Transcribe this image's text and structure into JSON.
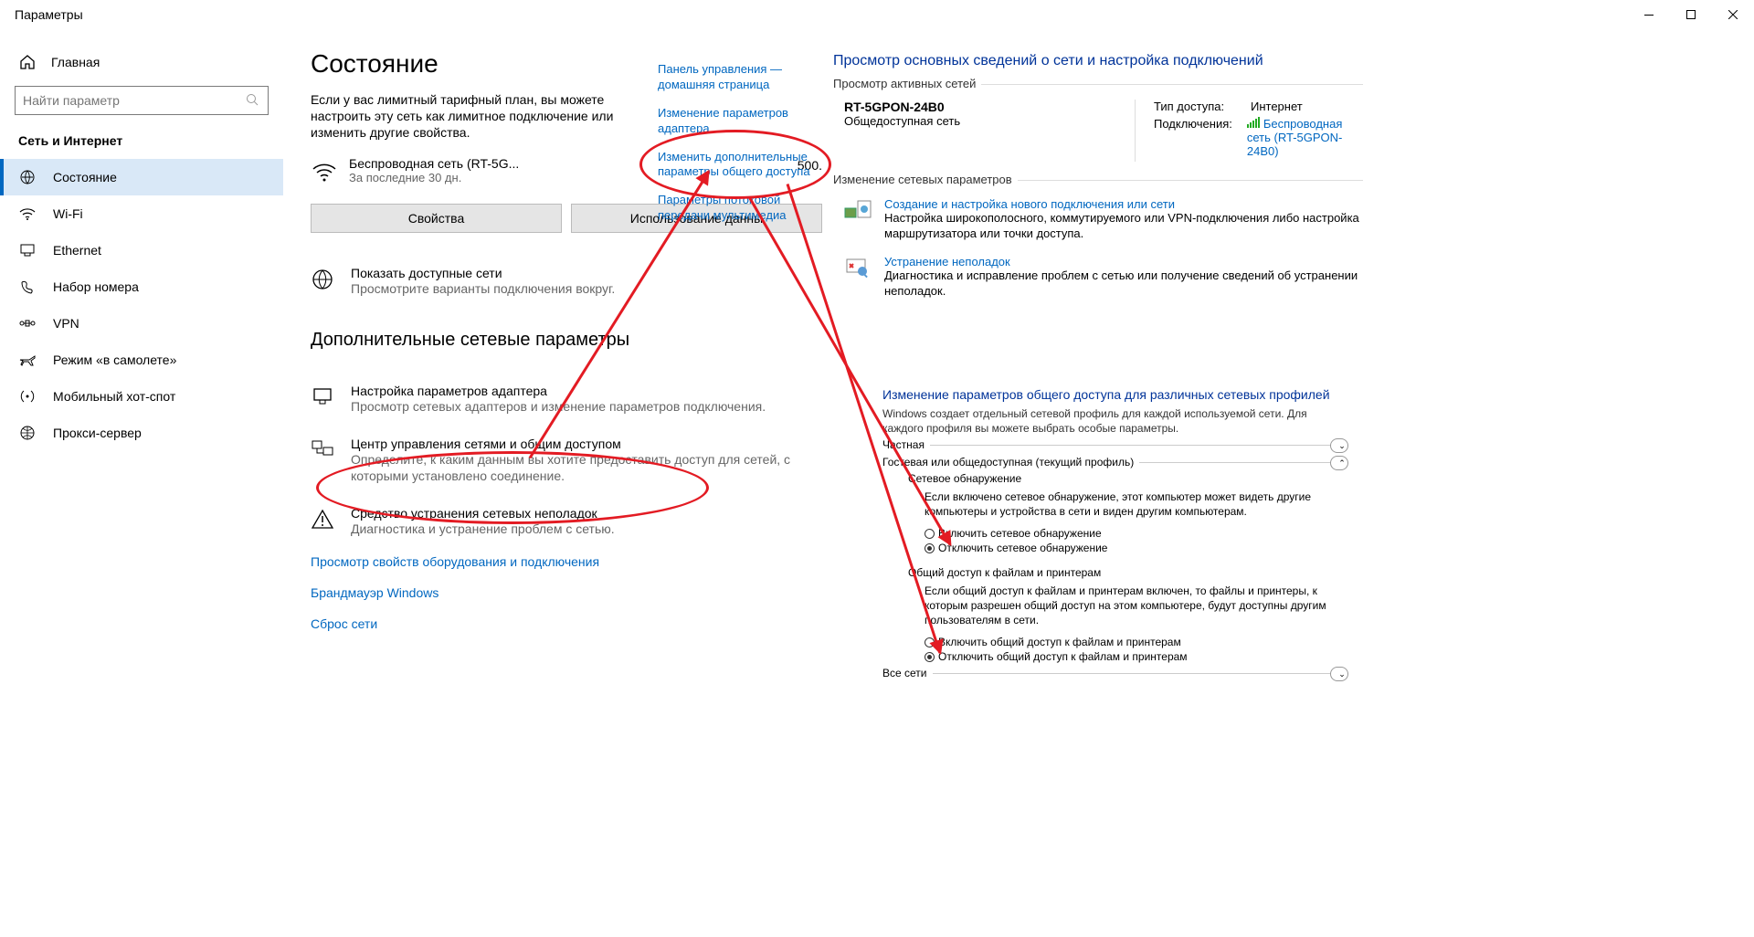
{
  "titlebar": {
    "title": "Параметры"
  },
  "sidebar": {
    "home": "Главная",
    "search_placeholder": "Найти параметр",
    "section": "Сеть и Интернет",
    "items": [
      {
        "label": "Состояние"
      },
      {
        "label": "Wi-Fi"
      },
      {
        "label": "Ethernet"
      },
      {
        "label": "Набор номера"
      },
      {
        "label": "VPN"
      },
      {
        "label": "Режим «в самолете»"
      },
      {
        "label": "Мобильный хот-спот"
      },
      {
        "label": "Прокси-сервер"
      }
    ]
  },
  "main": {
    "title": "Состояние",
    "desc": "Если у вас лимитный тарифный план, вы можете настроить эту сеть как лимитное подключение или изменить другие свойства.",
    "wifi_name": "Беспроводная сеть (RT-5G...",
    "wifi_sub": "За последние 30 дн.",
    "wifi_value": "500.",
    "btn_props": "Свойства",
    "btn_usage": "Использование данны",
    "avail_title": "Показать доступные сети",
    "avail_sub": "Просмотрите варианты подключения вокруг.",
    "adv_title": "Дополнительные сетевые параметры",
    "adapter_title": "Настройка параметров адаптера",
    "adapter_sub": "Просмотр сетевых адаптеров и изменение параметров подключения.",
    "center_title": "Центр управления сетями и общим доступом",
    "center_sub": "Определите, к каким данным вы хотите предоставить доступ для сетей, с которыми установлено соединение.",
    "trouble_title": "Средство устранения сетевых неполадок",
    "trouble_sub": "Диагностика и устранение проблем с сетью.",
    "link_hw": "Просмотр свойств оборудования и подключения",
    "link_fw": "Брандмауэр Windows",
    "link_reset": "Сброс сети"
  },
  "cpside": {
    "l1": "Панель управления — домашняя страница",
    "l2": "Изменение параметров адаптера",
    "l3": "Изменить дополнительные параметры общего доступа",
    "l4": "Параметры потоковой передачи мультимедиа"
  },
  "nc": {
    "title": "Просмотр основных сведений о сети и настройка подключений",
    "active_label": "Просмотр активных сетей",
    "net_name": "RT-5GPON-24B0",
    "net_type": "Общедоступная сеть",
    "k_access": "Тип доступа:",
    "v_access": "Интернет",
    "k_conn": "Подключения:",
    "v_conn": "Беспроводная сеть (RT-5GPON-24B0)",
    "change_label": "Изменение сетевых параметров",
    "task1_title": "Создание и настройка нового подключения или сети",
    "task1_sub": "Настройка широкополосного, коммутируемого или VPN-подключения либо настройка маршрутизатора или точки доступа.",
    "task2_title": "Устранение неполадок",
    "task2_sub": "Диагностика и исправление проблем с сетью или получение сведений об устранении неполадок."
  },
  "sh": {
    "title": "Изменение параметров общего доступа для различных сетевых профилей",
    "desc": "Windows создает отдельный сетевой профиль для каждой используемой сети. Для каждого профиля вы можете выбрать особые параметры.",
    "g_private": "Частная",
    "g_guest": "Гостевая или общедоступная (текущий профиль)",
    "g_all": "Все сети",
    "disc_head": "Сетевое обнаружение",
    "disc_text": "Если включено сетевое обнаружение, этот компьютер может видеть другие компьютеры и устройства в сети и виден другим компьютерам.",
    "disc_on": "Включить сетевое обнаружение",
    "disc_off": "Отключить сетевое обнаружение",
    "share_head": "Общий доступ к файлам и принтерам",
    "share_text": "Если общий доступ к файлам и принтерам включен, то файлы и принтеры, к которым разрешен общий доступ на этом компьютере, будут доступны другим пользователям в сети.",
    "share_on": "Включить общий доступ к файлам и принтерам",
    "share_off": "Отключить общий доступ к файлам и принтерам"
  }
}
